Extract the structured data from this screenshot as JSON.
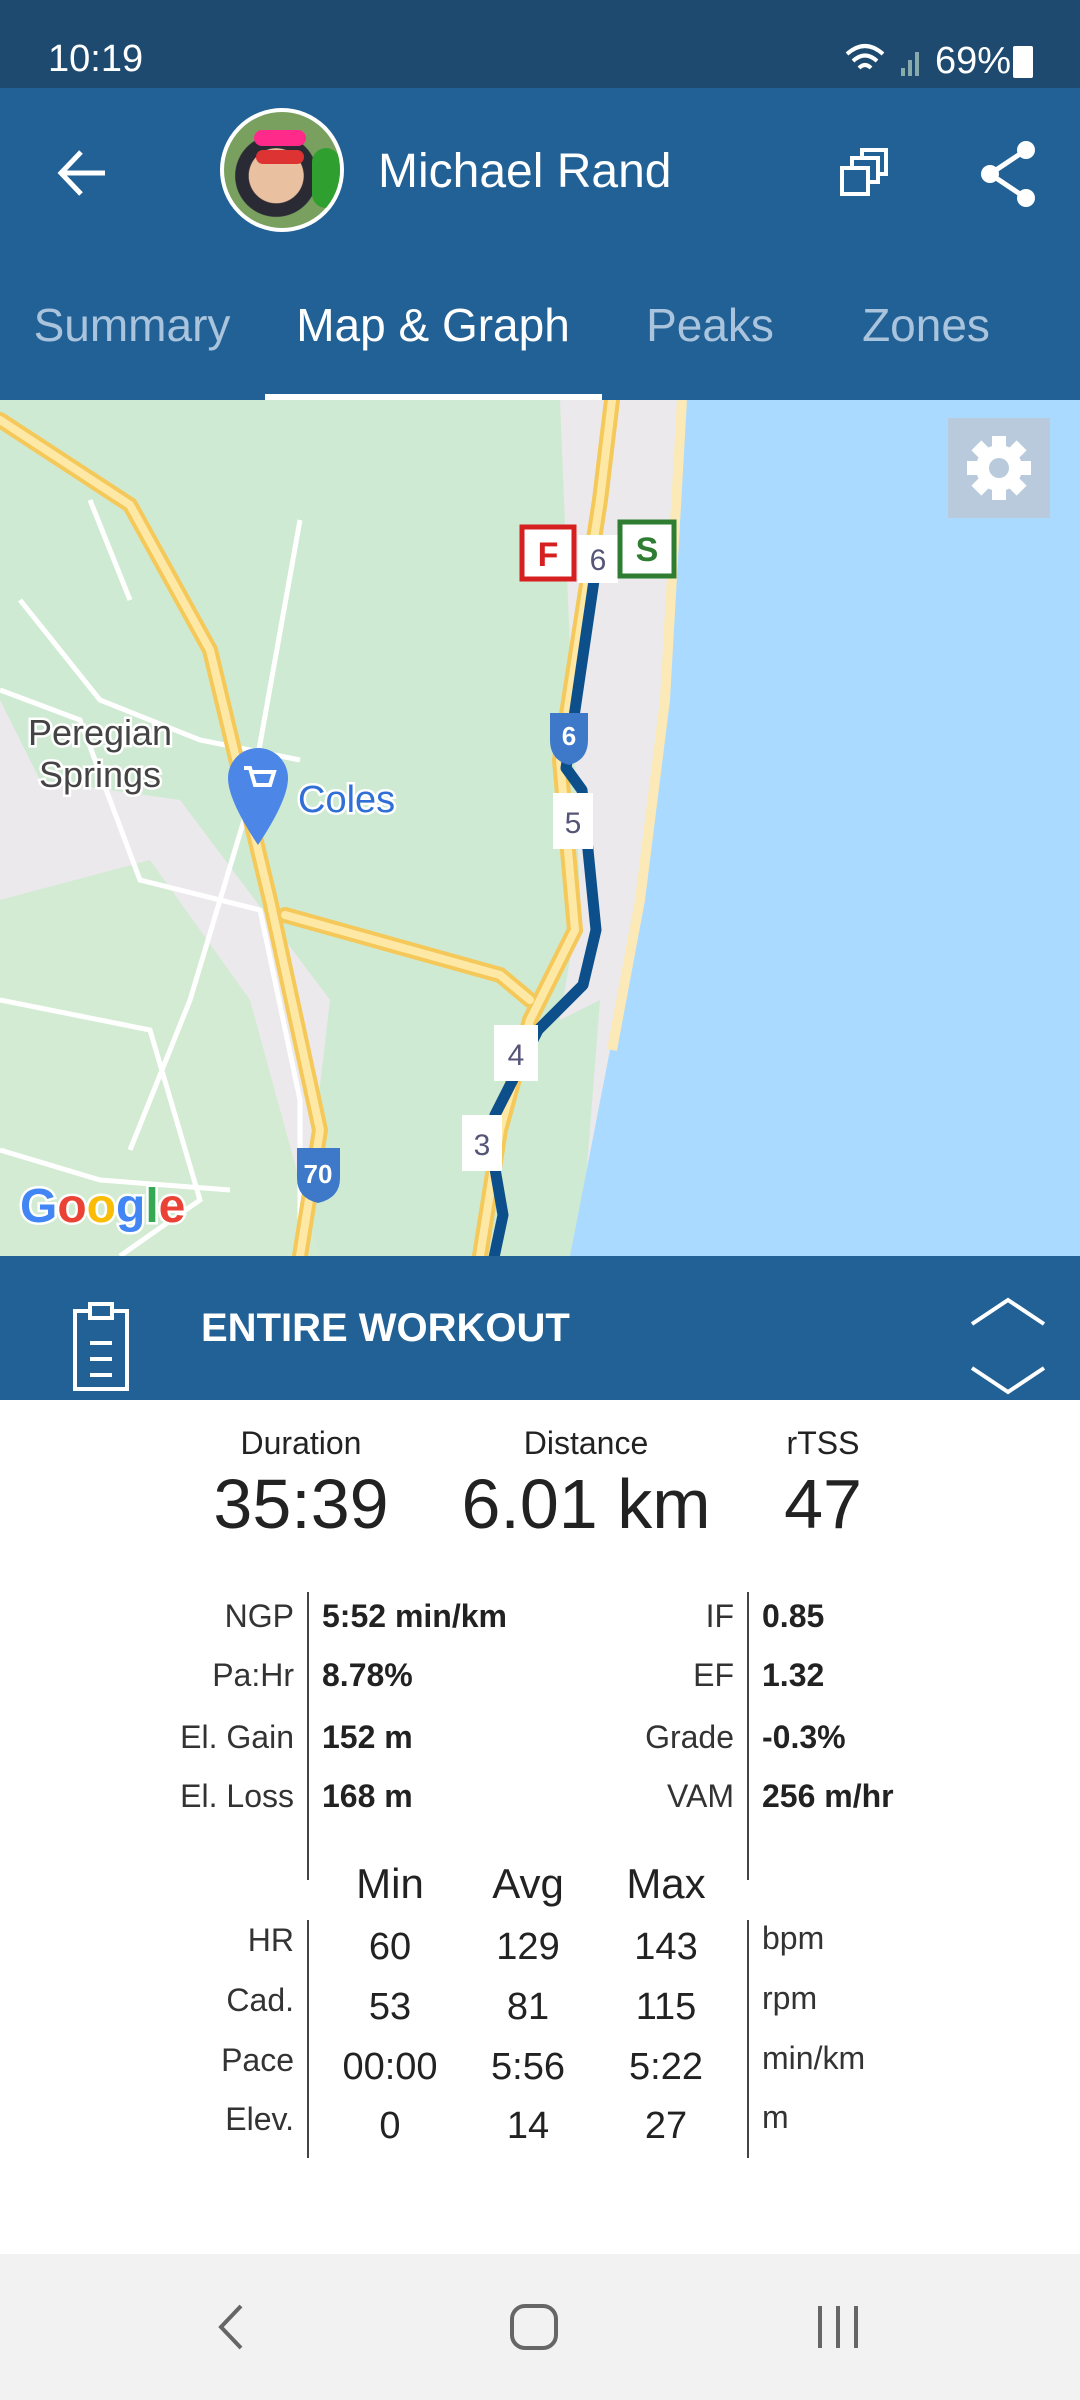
{
  "status_bar": {
    "time": "10:19",
    "battery": "69%"
  },
  "header": {
    "user_name": "Michael Rand"
  },
  "tabs": [
    {
      "label": "Summary"
    },
    {
      "label": "Map & Graph",
      "active": true
    },
    {
      "label": "Peaks"
    },
    {
      "label": "Zones"
    }
  ],
  "map": {
    "labels": {
      "place": [
        "Peregian",
        "Springs"
      ],
      "poi": "Coles",
      "hwy6": "6",
      "hwy70": "70",
      "google": "Google"
    },
    "markers": {
      "finish": "F",
      "start": "S",
      "km": [
        "6",
        "5",
        "4",
        "3"
      ]
    },
    "colors": {
      "route": "#0d4f8b",
      "water": "#aadaff",
      "park": "#c8e6c9",
      "road": "#fcd57a"
    }
  },
  "workout_bar": {
    "title": "ENTIRE WORKOUT"
  },
  "summary": [
    {
      "label": "Duration",
      "value": "35:39"
    },
    {
      "label": "Distance",
      "value": "6.01 km"
    },
    {
      "label": "rTSS",
      "value": "47"
    }
  ],
  "metrics_left": [
    {
      "label": "NGP",
      "value": "5:52 min/km"
    },
    {
      "label": "Pa:Hr",
      "value": "8.78%"
    },
    {
      "label": "El. Gain",
      "value": "152 m"
    },
    {
      "label": "El. Loss",
      "value": "168 m"
    }
  ],
  "metrics_right": [
    {
      "label": "IF",
      "value": "0.85"
    },
    {
      "label": "EF",
      "value": "1.32"
    },
    {
      "label": "Grade",
      "value": "-0.3%"
    },
    {
      "label": "VAM",
      "value": "256 m/hr"
    }
  ],
  "table": {
    "headers": [
      "Min",
      "Avg",
      "Max"
    ],
    "rows": [
      {
        "label": "HR",
        "min": "60",
        "avg": "129",
        "max": "143",
        "unit": "bpm"
      },
      {
        "label": "Cad.",
        "min": "53",
        "avg": "81",
        "max": "115",
        "unit": "rpm"
      },
      {
        "label": "Pace",
        "min": "00:00",
        "avg": "5:56",
        "max": "5:22",
        "unit": "min/km"
      },
      {
        "label": "Elev.",
        "min": "0",
        "avg": "14",
        "max": "27",
        "unit": "m"
      }
    ]
  }
}
